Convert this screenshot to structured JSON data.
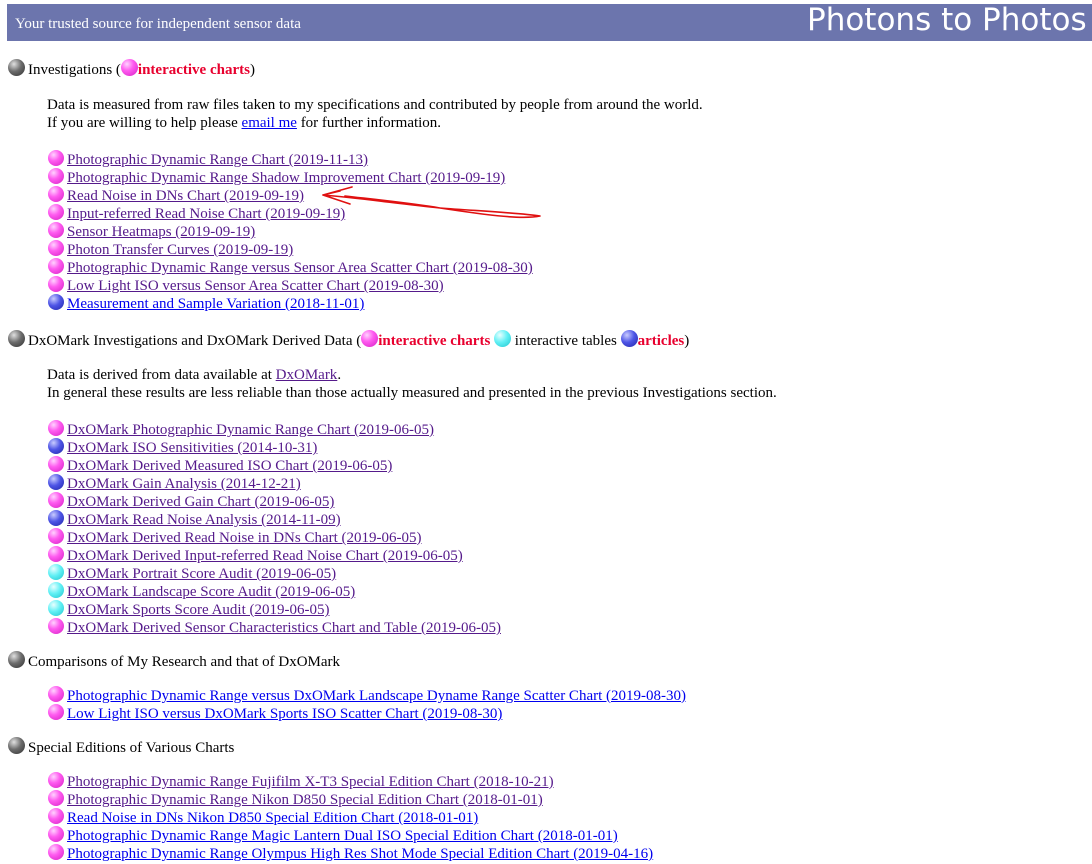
{
  "banner": {
    "tagline": "Your trusted source for independent sensor data",
    "title": "Photons to Photos"
  },
  "colors": {
    "banner": "#6c75ad",
    "highlight": "#e8002e",
    "visited_link": "#551a8b",
    "link": "#0000ee"
  },
  "investigations": {
    "heading_prefix": "Investigations (",
    "interactive_label": "interactive charts",
    "heading_suffix": ")",
    "intro_line1": "Data is measured from raw files taken to my specifications and contributed by people from around the world.",
    "intro_line2_prefix": "If you are willing to help please ",
    "email_link": "email me",
    "intro_line2_suffix": " for further information.",
    "items": [
      {
        "label": "Photographic Dynamic Range Chart (2019-11-13)",
        "icon": "pink-ball-icon"
      },
      {
        "label": "Photographic Dynamic Range Shadow Improvement Chart (2019-09-19)",
        "icon": "pink-ball-icon"
      },
      {
        "label": "Read Noise in DNs Chart (2019-09-19)",
        "icon": "pink-ball-icon"
      },
      {
        "label": "Input-referred Read Noise Chart (2019-09-19)",
        "icon": "pink-ball-icon"
      },
      {
        "label": "Sensor Heatmaps (2019-09-19)",
        "icon": "pink-ball-icon"
      },
      {
        "label": "Photon Transfer Curves (2019-09-19)",
        "icon": "pink-ball-icon"
      },
      {
        "label": "Photographic Dynamic Range versus Sensor Area Scatter Chart (2019-08-30)",
        "icon": "pink-ball-icon"
      },
      {
        "label": "Low Light ISO versus Sensor Area Scatter Chart (2019-08-30)",
        "icon": "pink-ball-icon"
      },
      {
        "label": "Measurement and Sample Variation (2018-11-01)",
        "icon": "blue-ball-icon"
      }
    ]
  },
  "dxomark": {
    "heading_prefix": "DxOMark Investigations and DxOMark Derived Data (",
    "interactive_label": "interactive charts",
    "tables_label": " interactive tables ",
    "articles_label": "articles",
    "heading_suffix": ")",
    "intro_line1_prefix": "Data is derived from data available at ",
    "dxomark_link": "DxOMark",
    "intro_line1_suffix": ".",
    "intro_line2": "In general these results are less reliable than those actually measured and presented in the previous Investigations section.",
    "items": [
      {
        "label": "DxOMark Photographic Dynamic Range Chart (2019-06-05)",
        "icon": "pink-ball-icon"
      },
      {
        "label": "DxOMark ISO Sensitivities (2014-10-31)",
        "icon": "blue-ball-icon"
      },
      {
        "label": "DxOMark Derived Measured ISO Chart (2019-06-05)",
        "icon": "pink-ball-icon"
      },
      {
        "label": "DxOMark Gain Analysis (2014-12-21)",
        "icon": "blue-ball-icon"
      },
      {
        "label": "DxOMark Derived Gain Chart (2019-06-05)",
        "icon": "pink-ball-icon"
      },
      {
        "label": "DxOMark Read Noise Analysis (2014-11-09)",
        "icon": "blue-ball-icon"
      },
      {
        "label": "DxOMark Derived Read Noise in DNs Chart (2019-06-05)",
        "icon": "pink-ball-icon"
      },
      {
        "label": "DxOMark Derived Input-referred Read Noise Chart (2019-06-05)",
        "icon": "pink-ball-icon"
      },
      {
        "label": "DxOMark Portrait Score Audit (2019-06-05)",
        "icon": "cyan-ball-icon"
      },
      {
        "label": "DxOMark Landscape Score Audit (2019-06-05)",
        "icon": "cyan-ball-icon"
      },
      {
        "label": "DxOMark Sports Score Audit (2019-06-05)",
        "icon": "cyan-ball-icon"
      },
      {
        "label": "DxOMark Derived Sensor Characteristics Chart and Table (2019-06-05)",
        "icon": "pink-ball-icon"
      }
    ]
  },
  "comparisons": {
    "heading": "Comparisons of My Research and that of DxOMark",
    "items": [
      {
        "label": "Photographic Dynamic Range versus DxOMark Landscape Dyname Range Scatter Chart (2019-08-30)",
        "icon": "pink-ball-icon"
      },
      {
        "label": "Low Light ISO versus DxOMark Sports ISO Scatter Chart (2019-08-30)",
        "icon": "pink-ball-icon"
      }
    ]
  },
  "special": {
    "heading": "Special Editions of Various Charts",
    "items": [
      {
        "label": "Photographic Dynamic Range Fujifilm X-T3 Special Edition Chart (2018-10-21)",
        "icon": "pink-ball-icon"
      },
      {
        "label": "Photographic Dynamic Range Nikon D850 Special Edition Chart (2018-01-01)",
        "icon": "pink-ball-icon"
      },
      {
        "label": "Read Noise in DNs Nikon D850 Special Edition Chart (2018-01-01)",
        "icon": "pink-ball-icon"
      },
      {
        "label": "Photographic Dynamic Range Magic Lantern Dual ISO Special Edition Chart (2018-01-01)",
        "icon": "pink-ball-icon"
      },
      {
        "label": "Photographic Dynamic Range Olympus High Res Shot Mode Special Edition Chart (2019-04-16)",
        "icon": "pink-ball-icon"
      }
    ]
  }
}
